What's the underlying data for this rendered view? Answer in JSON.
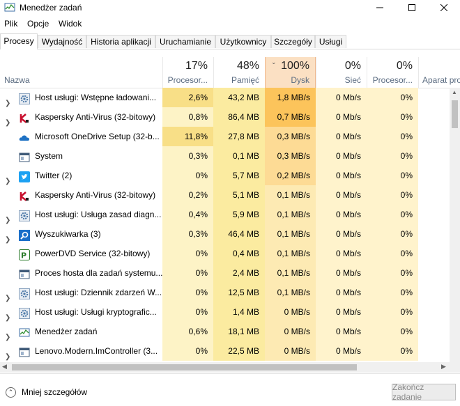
{
  "window": {
    "title": "Menedżer zadań"
  },
  "menu": [
    "Plik",
    "Opcje",
    "Widok"
  ],
  "tabs": [
    "Procesy",
    "Wydajność",
    "Historia aplikacji",
    "Uruchamianie",
    "Użytkownicy",
    "Szczegóły",
    "Usługi"
  ],
  "header": {
    "name": "Nazwa",
    "cpu_pct": "17%",
    "cpu": "Procesor...",
    "mem_pct": "48%",
    "mem": "Pamięć",
    "disk_pct": "100%",
    "disk": "Dysk",
    "net_pct": "0%",
    "net": "Sieć",
    "gpu_pct": "0%",
    "gpu": "Procesor...",
    "gpu_engine": "Aparat pro"
  },
  "processes": [
    {
      "name": "Host usługi: Wstępne ładowani...",
      "cpu": "2,6%",
      "mem": "43,2 MB",
      "disk": "1,8 MB/s",
      "net": "0 Mb/s",
      "gpu": "0%",
      "icon": "gear-icon",
      "expand": true
    },
    {
      "name": "Kaspersky Anti-Virus (32-bitowy)",
      "cpu": "0,8%",
      "mem": "86,4 MB",
      "disk": "0,7 MB/s",
      "net": "0 Mb/s",
      "gpu": "0%",
      "icon": "kaspersky-icon",
      "expand": true
    },
    {
      "name": "Microsoft OneDrive Setup (32-b...",
      "cpu": "11,8%",
      "mem": "27,8 MB",
      "disk": "0,3 MB/s",
      "net": "0 Mb/s",
      "gpu": "0%",
      "icon": "cloud-icon",
      "expand": false
    },
    {
      "name": "System",
      "cpu": "0,3%",
      "mem": "0,1 MB",
      "disk": "0,3 MB/s",
      "net": "0 Mb/s",
      "gpu": "0%",
      "icon": "window-icon",
      "expand": false
    },
    {
      "name": "Twitter (2)",
      "cpu": "0%",
      "mem": "5,7 MB",
      "disk": "0,2 MB/s",
      "net": "0 Mb/s",
      "gpu": "0%",
      "icon": "twitter-icon",
      "expand": true
    },
    {
      "name": "Kaspersky Anti-Virus (32-bitowy)",
      "cpu": "0,2%",
      "mem": "5,1 MB",
      "disk": "0,1 MB/s",
      "net": "0 Mb/s",
      "gpu": "0%",
      "icon": "kaspersky-icon",
      "expand": false
    },
    {
      "name": "Host usługi: Usługa zasad diagn...",
      "cpu": "0,4%",
      "mem": "5,9 MB",
      "disk": "0,1 MB/s",
      "net": "0 Mb/s",
      "gpu": "0%",
      "icon": "gear-icon",
      "expand": true
    },
    {
      "name": "Wyszukiwarka (3)",
      "cpu": "0,3%",
      "mem": "46,4 MB",
      "disk": "0,1 MB/s",
      "net": "0 Mb/s",
      "gpu": "0%",
      "icon": "search-icon",
      "expand": true
    },
    {
      "name": "PowerDVD Service (32-bitowy)",
      "cpu": "0%",
      "mem": "0,4 MB",
      "disk": "0,1 MB/s",
      "net": "0 Mb/s",
      "gpu": "0%",
      "icon": "powerdvd-icon",
      "expand": false
    },
    {
      "name": "Proces hosta dla zadań systemu...",
      "cpu": "0%",
      "mem": "2,4 MB",
      "disk": "0,1 MB/s",
      "net": "0 Mb/s",
      "gpu": "0%",
      "icon": "window-icon",
      "expand": false
    },
    {
      "name": "Host usługi: Dziennik zdarzeń W...",
      "cpu": "0%",
      "mem": "12,5 MB",
      "disk": "0,1 MB/s",
      "net": "0 Mb/s",
      "gpu": "0%",
      "icon": "gear-icon",
      "expand": true
    },
    {
      "name": "Host usługi: Usługi kryptografic...",
      "cpu": "0%",
      "mem": "1,4 MB",
      "disk": "0 MB/s",
      "net": "0 Mb/s",
      "gpu": "0%",
      "icon": "gear-icon",
      "expand": true
    },
    {
      "name": "Menedżer zadań",
      "cpu": "0,6%",
      "mem": "18,1 MB",
      "disk": "0 MB/s",
      "net": "0 Mb/s",
      "gpu": "0%",
      "icon": "taskmgr-icon",
      "expand": true
    },
    {
      "name": "Lenovo.Modern.ImController (3...",
      "cpu": "0%",
      "mem": "22,5 MB",
      "disk": "0 MB/s",
      "net": "0 Mb/s",
      "gpu": "0%",
      "icon": "window-icon",
      "expand": true
    }
  ],
  "footer": {
    "less": "Mniej szczegółów",
    "end": "Zakończ zadanie"
  },
  "colors": {
    "cpu_hi": "#f8df87",
    "cpu": "#fdf3c6",
    "mem": "#fbeba0",
    "disk_hi": "#fcc45b",
    "disk_mid": "#fddb95",
    "disk": "#fdeab3",
    "net": "#fff3cc",
    "gpu": "#fff3cc"
  }
}
